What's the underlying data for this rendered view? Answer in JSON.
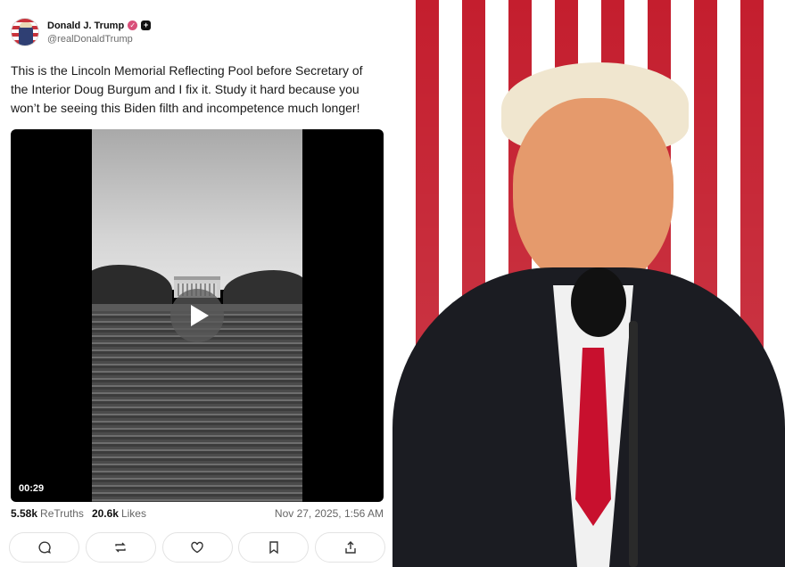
{
  "post": {
    "author": {
      "display_name": "Donald J. Trump",
      "handle": "@realDonaldTrump",
      "verified_icon": "verified-check-icon",
      "badge_icon": "plus-badge-icon"
    },
    "text": "This is the Lincoln Memorial Reflecting Pool before Secretary of the Interior Doug Burgum and I fix it. Study it hard because you won’t be seeing this Biden filth and incompetence much longer!",
    "video": {
      "duration": "00:29"
    },
    "stats": {
      "retruths_count": "5.58k",
      "retruths_label": "ReTruths",
      "likes_count": "20.6k",
      "likes_label": "Likes",
      "timestamp": "Nov 27, 2025, 1:56 AM"
    },
    "actions": [
      {
        "icon": "reply-icon"
      },
      {
        "icon": "retruth-icon"
      },
      {
        "icon": "like-heart-icon"
      },
      {
        "icon": "bookmark-icon"
      },
      {
        "icon": "share-icon"
      }
    ]
  },
  "colors": {
    "verified": "#d9507a",
    "flag_red": "#c41e2e",
    "tie_red": "#c8102e"
  }
}
